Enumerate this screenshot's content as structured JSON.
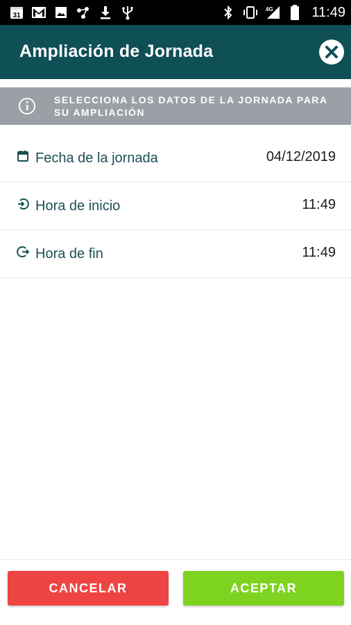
{
  "status_bar": {
    "time": "11:49",
    "left_icons": [
      "calendar-31-icon",
      "gmail-icon",
      "image-icon",
      "dots-icon",
      "download-icon",
      "usb-icon"
    ],
    "right_icons": [
      "bluetooth-icon",
      "vibrate-icon",
      "signal-4g-icon",
      "battery-icon"
    ],
    "calendar_day": "31",
    "network": "4G"
  },
  "header": {
    "title": "Ampliación de Jornada",
    "background": "#0f4f56"
  },
  "info_banner": {
    "text": "SELECCIONA LOS DATOS DE LA JORNADA PARA SU AMPLIACIÓN",
    "background": "#9aa0a6"
  },
  "rows": [
    {
      "icon": "calendar-icon",
      "label": "Fecha de la jornada",
      "value": "04/12/2019"
    },
    {
      "icon": "login-clock-icon",
      "label": "Hora de inicio",
      "value": "11:49"
    },
    {
      "icon": "logout-clock-icon",
      "label": "Hora de fin",
      "value": "11:49"
    }
  ],
  "buttons": {
    "cancel_label": "CANCELAR",
    "accept_label": "ACEPTAR",
    "cancel_color": "#ef4444",
    "accept_color": "#7ed321"
  }
}
